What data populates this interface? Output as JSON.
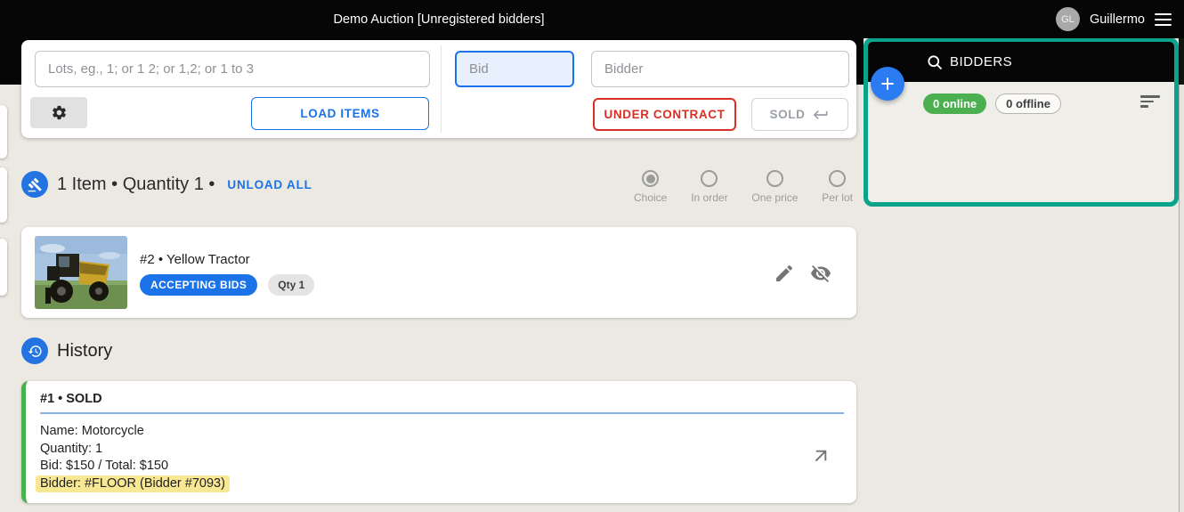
{
  "app_bar": {
    "title": "Demo Auction [Unregistered bidders]",
    "user": {
      "initials": "GL",
      "name": "Guillermo"
    }
  },
  "control_panel": {
    "lots_input": {
      "value": "",
      "placeholder": "Lots, eg., 1; or 1 2; or 1,2; or 1 to 3"
    },
    "load_items_label": "LOAD ITEMS",
    "bid_input": {
      "value": "",
      "placeholder": "Bid"
    },
    "bidder_input": {
      "value": "",
      "placeholder": "Bidder"
    },
    "under_contract_label": "UNDER CONTRACT",
    "sold_label": "SOLD"
  },
  "items_section": {
    "summary": "1 Item • Quantity 1 •",
    "unload_all_label": "UNLOAD ALL",
    "sale_modes": [
      {
        "label": "Choice",
        "selected": true
      },
      {
        "label": "In order",
        "selected": false
      },
      {
        "label": "One price",
        "selected": false
      },
      {
        "label": "Per lot",
        "selected": false
      }
    ],
    "items": [
      {
        "title": "#2 • Yellow Tractor",
        "status_badge": "ACCEPTING BIDS",
        "qty_badge": "Qty 1"
      }
    ]
  },
  "history_section": {
    "title": "History",
    "entries": [
      {
        "header": "#1 • SOLD",
        "lines": [
          "Name: Motorcycle",
          "Quantity: 1",
          "Bid: $150 / Total: $150"
        ],
        "highlighted_line": "Bidder: #FLOOR (Bidder #7093)"
      }
    ]
  },
  "bidders_panel": {
    "title": "BIDDERS",
    "online_badge": "0 online",
    "offline_badge": "0 offline"
  },
  "colors": {
    "accent_blue": "#1a73e8",
    "fab_blue": "#2b7bf3",
    "alert_red": "#d93025",
    "success_green": "#4caf50",
    "panel_teal": "#09a48a",
    "highlight_yellow": "#f8e793",
    "appbar_black": "#060606",
    "background": "#ece9e3"
  }
}
